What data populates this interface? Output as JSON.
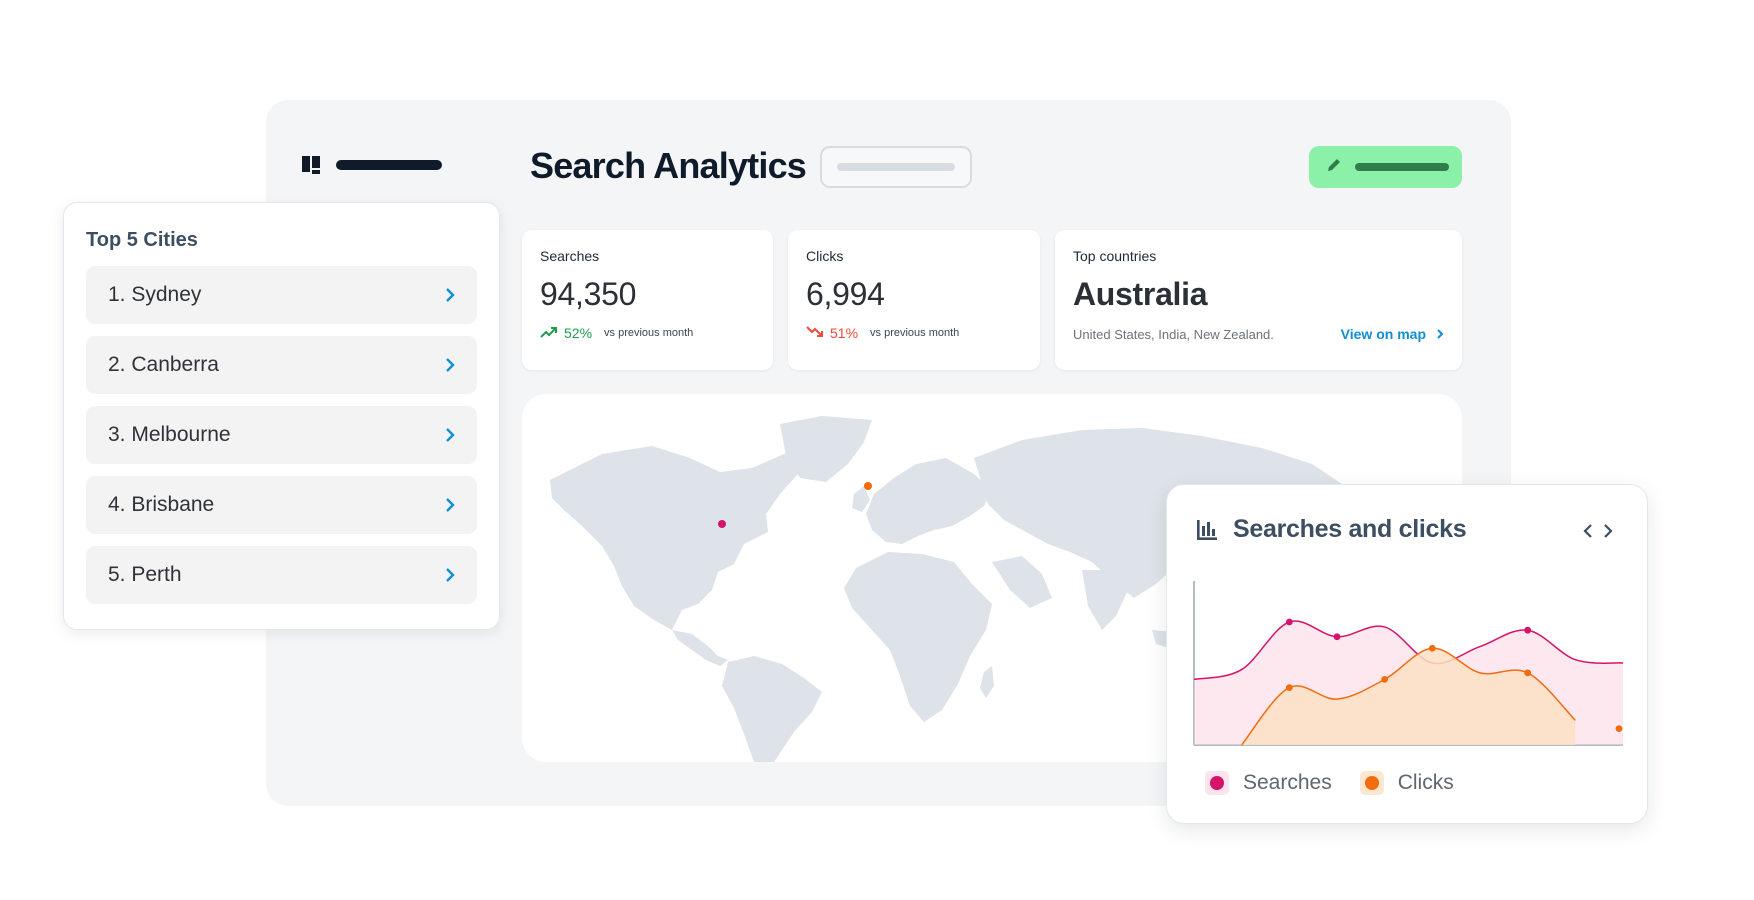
{
  "header": {
    "title": "Search Analytics"
  },
  "stats": {
    "searches": {
      "label": "Searches",
      "value": "94,350",
      "change": "52%",
      "direction": "up",
      "compare": "vs previous month"
    },
    "clicks": {
      "label": "Clicks",
      "value": "6,994",
      "change": "51%",
      "direction": "down",
      "compare": "vs previous month"
    },
    "countries": {
      "label": "Top countries",
      "value": "Australia",
      "others": "United States, India, New Zealand.",
      "link": "View on map"
    }
  },
  "cities": {
    "title": "Top 5 Cities",
    "items": [
      {
        "label": "1. Sydney"
      },
      {
        "label": "2. Canberra"
      },
      {
        "label": "3. Melbourne"
      },
      {
        "label": "4. Brisbane"
      },
      {
        "label": "5. Perth"
      }
    ]
  },
  "map": {
    "markers": [
      {
        "name": "Searches",
        "color": "#d6136b"
      },
      {
        "name": "Clicks",
        "color": "#f26b0f"
      }
    ]
  },
  "chart": {
    "title": "Searches and clicks",
    "icon": "bar-chart-icon",
    "legend": [
      "Searches",
      "Clicks"
    ]
  },
  "colors": {
    "accent_green": "#8bf0a8",
    "link_blue": "#0f8ed6",
    "searches": "#d6136b",
    "clicks": "#f26b0f"
  },
  "chart_data": {
    "type": "area",
    "title": "Searches and clicks",
    "xlabel": "",
    "ylabel": "",
    "ylim": [
      0,
      100
    ],
    "x": [
      0,
      1,
      2,
      3,
      4,
      5,
      6,
      7,
      8,
      9
    ],
    "series": [
      {
        "name": "Searches",
        "color": "#d6136b",
        "values": [
          40,
          46,
          75,
          66,
          72,
          50,
          60,
          70,
          52,
          50
        ]
      },
      {
        "name": "Clicks",
        "color": "#f26b0f",
        "values": [
          null,
          0,
          35,
          28,
          40,
          59,
          44,
          44,
          15,
          null
        ]
      }
    ],
    "grid": false,
    "legend_position": "bottom-left"
  }
}
